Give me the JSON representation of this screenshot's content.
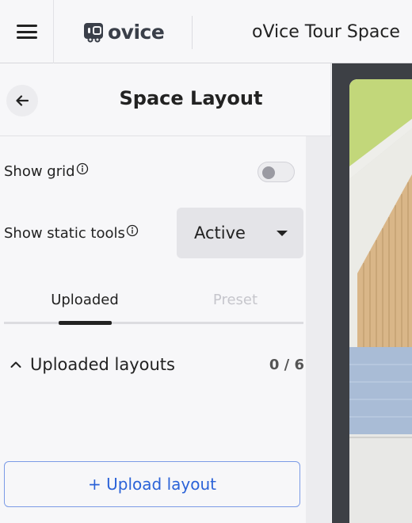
{
  "header": {
    "menu_icon": "hamburger-menu-icon",
    "logo_text": "ovice",
    "space_name": "oVice Tour Space"
  },
  "sidebar": {
    "back_icon": "arrow-left-icon",
    "title": "Space Layout",
    "show_grid": {
      "label": "Show grid",
      "info_icon": "info-icon",
      "enabled": false
    },
    "show_static_tools": {
      "label": "Show static tools",
      "info_icon": "info-icon",
      "selected": "Active"
    },
    "tabs": [
      {
        "label": "Uploaded",
        "active": true
      },
      {
        "label": "Preset",
        "active": false
      }
    ],
    "uploaded_section": {
      "title": "Uploaded layouts",
      "count": "0 / 6",
      "expanded": true,
      "chevron_icon": "chevron-up-icon"
    },
    "upload_button": "+ Upload layout"
  },
  "colors": {
    "accent": "#2c63d8",
    "panel": "#f7f7f9",
    "canvas": "#3d4045"
  }
}
